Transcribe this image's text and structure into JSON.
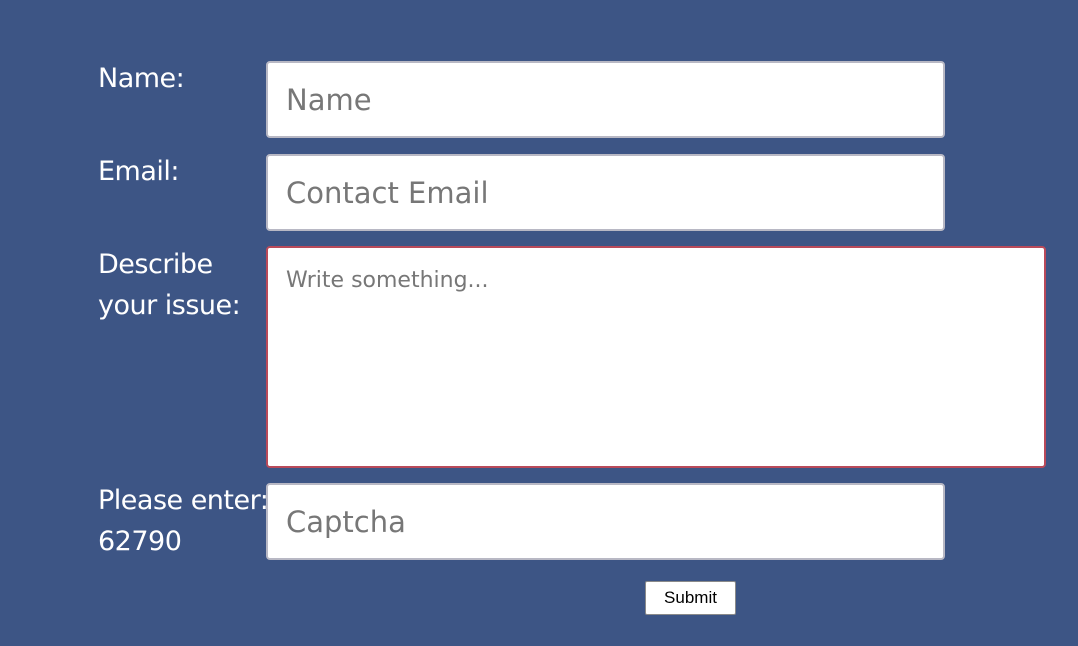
{
  "form": {
    "name": {
      "label": "Name:",
      "placeholder": "Name",
      "value": ""
    },
    "email": {
      "label": "Email:",
      "placeholder": "Contact Email",
      "value": ""
    },
    "issue": {
      "label_line1": "Describe",
      "label_line2": "your issue:",
      "placeholder": "Write something...",
      "value": ""
    },
    "captcha": {
      "label_line1": "Please enter:",
      "code": "62790",
      "placeholder": "Captcha",
      "value": ""
    },
    "submit_label": "Submit"
  },
  "colors": {
    "background": "#3d5585",
    "label_text": "#ffffff",
    "field_border": "#b8b8c4",
    "textarea_border": "#b94a5a",
    "placeholder_text": "#777777"
  }
}
